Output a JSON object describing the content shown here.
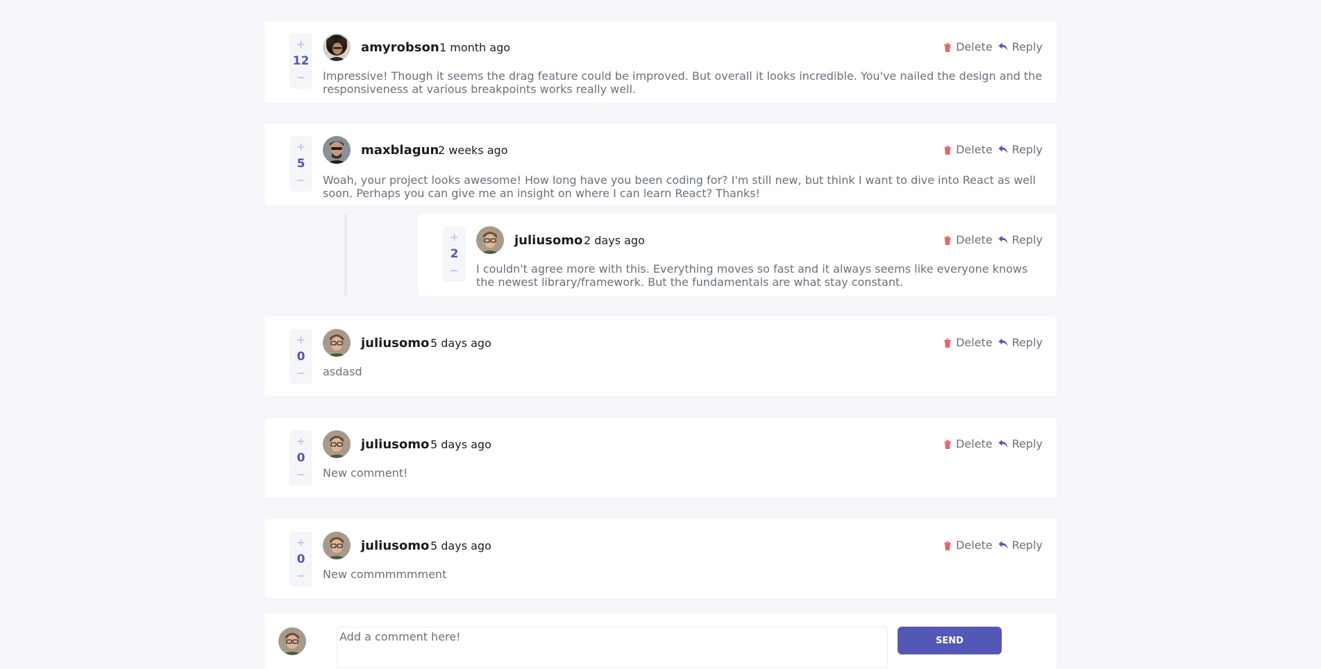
{
  "colors": {
    "accent": "#5357b6",
    "delete": "#ed6368",
    "vote_light": "#c5c6ef",
    "background": "#f5f6fa",
    "text": "#67727e",
    "heading": "#1c1c1c"
  },
  "actions": {
    "delete_label": "Delete",
    "reply_label": "Reply",
    "delete_icon": "trash-icon",
    "reply_icon": "reply-arrow-icon"
  },
  "vote_icons": {
    "plus": "+",
    "minus": "−"
  },
  "comments": [
    {
      "author": "amyrobson",
      "time": "1 month ago",
      "score": "12",
      "avatar": "avatar-amyrobson",
      "text": "Impressive! Though it seems the drag feature could be improved. But overall it looks incredible. You've nailed the design and the responsiveness at various breakpoints works really well."
    },
    {
      "author": "maxblagun",
      "time": "2 weeks ago",
      "score": "5",
      "avatar": "avatar-maxblagun",
      "text": "Woah, your project looks awesome! How long have you been coding for? I'm still new, but think I want to dive into React as well soon. Perhaps you can give me an insight on where I can learn React? Thanks!",
      "replies": [
        {
          "author": "juliusomo",
          "time": "2 days ago",
          "score": "2",
          "avatar": "avatar-juliusomo",
          "text": "I couldn't agree more with this. Everything moves so fast and it always seems like everyone knows the newest library/framework. But the fundamentals are what stay constant."
        }
      ]
    },
    {
      "author": "juliusomo",
      "time": "5 days ago",
      "score": "0",
      "avatar": "avatar-juliusomo",
      "text": "asdasd"
    },
    {
      "author": "juliusomo",
      "time": "5 days ago",
      "score": "0",
      "avatar": "avatar-juliusomo",
      "text": "New comment!"
    },
    {
      "author": "juliusomo",
      "time": "5 days ago",
      "score": "0",
      "avatar": "avatar-juliusomo",
      "text": "New commmmmment"
    }
  ],
  "composer": {
    "placeholder": "Add a comment here!",
    "value": "",
    "send_label": "SEND",
    "avatar": "avatar-juliusomo"
  }
}
